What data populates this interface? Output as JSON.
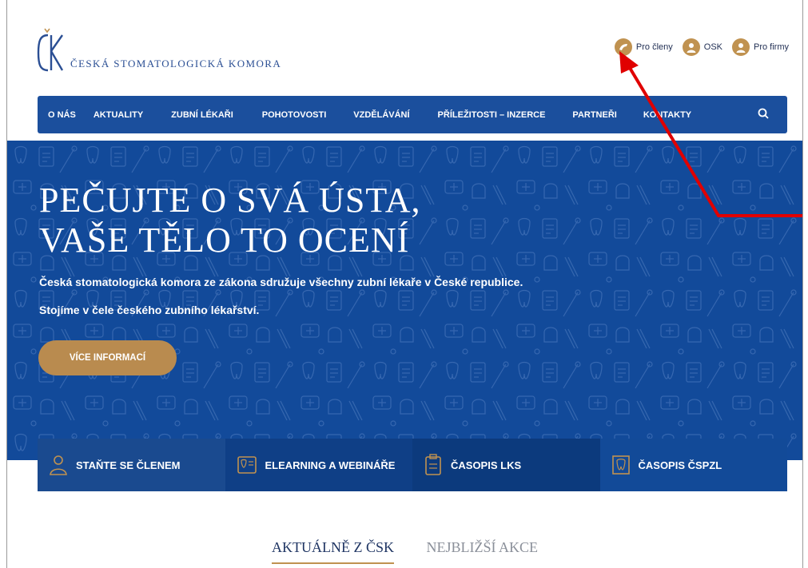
{
  "brand": {
    "name": "ČESKÁ STOMATOLOGICKÁ KOMORA",
    "mark": "ČSK"
  },
  "toplinks": [
    {
      "label": "Pro členy",
      "icon": "tooth-drill-icon"
    },
    {
      "label": "OSK",
      "icon": "user-icon"
    },
    {
      "label": "Pro firmy",
      "icon": "user-icon"
    }
  ],
  "nav": {
    "items": [
      "O NÁS",
      "AKTUALITY",
      "ZUBNÍ LÉKAŘI",
      "POHOTOVOSTI",
      "VZDĚLÁVÁNÍ",
      "PŘÍLEŽITOSTI – INZERCE",
      "PARTNEŘI",
      "KONTAKTY"
    ],
    "search_icon": "search-icon"
  },
  "hero": {
    "title_line1": "PEČUJTE O SVÁ ÚSTA,",
    "title_line2": "VAŠE TĚLO TO OCENÍ",
    "sub_line1": "Česká stomatologická komora ze zákona sdružuje všechny zubní lékaře v České republice.",
    "sub_line2": "Stojíme v čele českého zubního lékařství.",
    "cta": "VÍCE INFORMACÍ"
  },
  "tiles": [
    {
      "label": "STAŇTE SE ČLENEM",
      "icon": "member-icon"
    },
    {
      "label": "ELEARNING A WEBINÁŘE",
      "icon": "elearning-icon"
    },
    {
      "label": "ČASOPIS LKS",
      "icon": "clipboard-icon"
    },
    {
      "label": "ČASOPIS ČSPZL",
      "icon": "tooth-frame-icon"
    }
  ],
  "tabs": [
    {
      "label": "AKTUÁLNĚ Z ČSK",
      "active": true
    },
    {
      "label": "NEJBLIŽŠÍ AKCE",
      "active": false
    }
  ],
  "colors": {
    "nav": "#1b4f9d",
    "hero": "#124a9a",
    "accent_gold": "#b98b4f",
    "annotation_arrow": "#e00000",
    "tile_bg": [
      "#1a4a8f",
      "#0f3f86",
      "#0c3a7d",
      "#124a98"
    ]
  }
}
